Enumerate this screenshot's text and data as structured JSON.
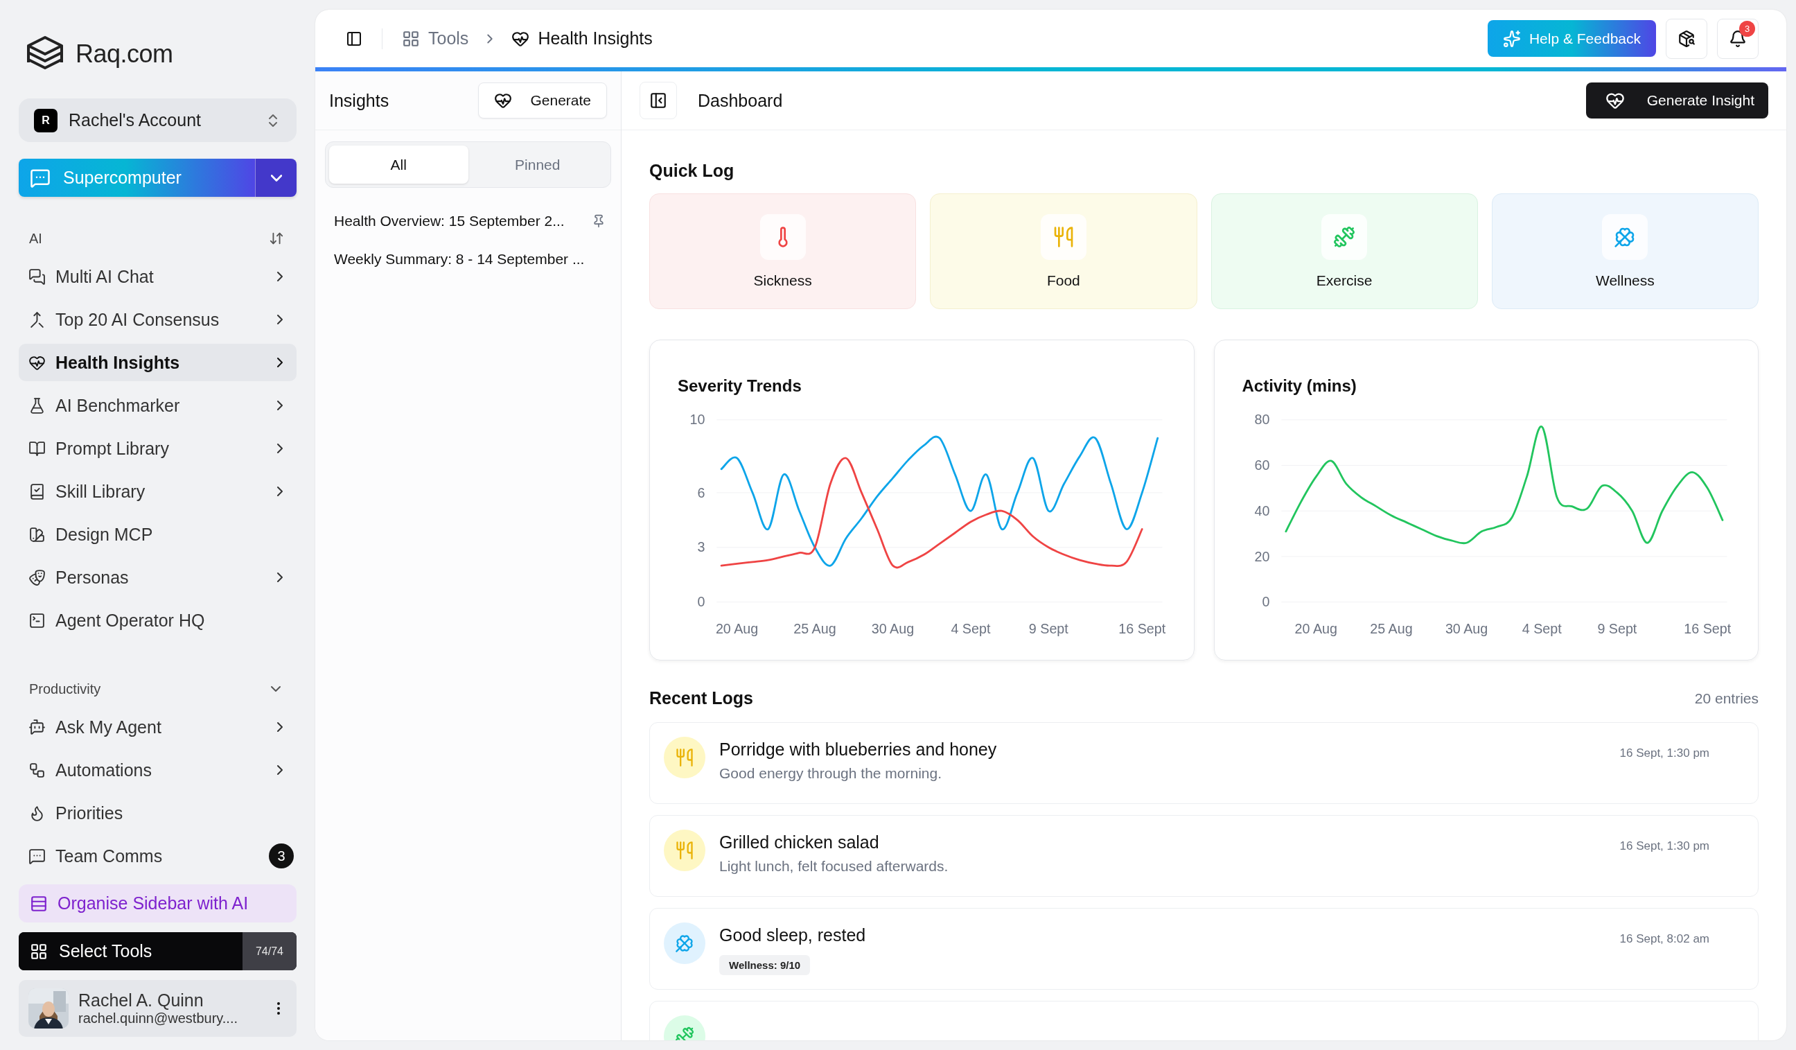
{
  "brand": {
    "name": "Raq.com"
  },
  "account": {
    "initial": "R",
    "name": "Rachel's Account"
  },
  "primary_action": {
    "label": "Supercomputer"
  },
  "sections": [
    {
      "title": "AI",
      "kind": "sortable",
      "items": [
        {
          "label": "Multi AI Chat",
          "expandable": true,
          "selected": false
        },
        {
          "label": "Top 20 AI Consensus",
          "expandable": true,
          "selected": false
        },
        {
          "label": "Health Insights",
          "expandable": true,
          "selected": true
        },
        {
          "label": "AI Benchmarker",
          "expandable": true,
          "selected": false
        },
        {
          "label": "Prompt Library",
          "expandable": true,
          "selected": false
        },
        {
          "label": "Skill Library",
          "expandable": true,
          "selected": false
        },
        {
          "label": "Design MCP",
          "expandable": false,
          "selected": false
        },
        {
          "label": "Personas",
          "expandable": true,
          "selected": false
        },
        {
          "label": "Agent Operator HQ",
          "expandable": false,
          "selected": false
        }
      ]
    },
    {
      "title": "Productivity",
      "kind": "collapsible",
      "expanded": true,
      "items": [
        {
          "label": "Ask My Agent",
          "expandable": true,
          "selected": false
        },
        {
          "label": "Automations",
          "expandable": true,
          "selected": false
        },
        {
          "label": "Priorities",
          "expandable": false,
          "selected": false
        },
        {
          "label": "Team Comms",
          "expandable": false,
          "selected": false,
          "badge": "3"
        }
      ]
    }
  ],
  "organise": {
    "label": "Organise Sidebar with AI"
  },
  "select_tools": {
    "label": "Select Tools",
    "count": "74/74"
  },
  "user": {
    "name": "Rachel A. Quinn",
    "email": "rachel.quinn@westbury...."
  },
  "breadcrumb": [
    {
      "label": "Tools"
    },
    {
      "label": "Health Insights"
    }
  ],
  "help_button": {
    "label": "Help & Feedback"
  },
  "notifications": {
    "count": "3"
  },
  "insights": {
    "title": "Insights",
    "generate": "Generate",
    "tabs": [
      {
        "label": "All",
        "selected": true
      },
      {
        "label": "Pinned",
        "selected": false
      }
    ],
    "items": [
      {
        "title": "Health Overview: 15 September 2...",
        "pinned": true
      },
      {
        "title": "Weekly Summary: 8 - 14 September ...",
        "pinned": false
      }
    ]
  },
  "dashboard": {
    "title": "Dashboard",
    "generate": "Generate Insight",
    "quick_log": {
      "title": "Quick Log",
      "cards": [
        {
          "label": "Sickness",
          "kind": "sickness"
        },
        {
          "label": "Food",
          "kind": "food"
        },
        {
          "label": "Exercise",
          "kind": "exercise"
        },
        {
          "label": "Wellness",
          "kind": "wellness"
        }
      ]
    },
    "charts": [
      {
        "chart_data": {
          "type": "line",
          "title": "Severity Trends",
          "grid": true,
          "categories": [
            null,
            "20 Aug",
            null,
            null,
            null,
            null,
            "25 Aug",
            null,
            null,
            null,
            null,
            "30 Aug",
            null,
            null,
            null,
            null,
            "4 Sept",
            null,
            null,
            null,
            null,
            "9 Sept",
            null,
            null,
            null,
            null,
            null,
            "16 Sept",
            null
          ],
          "ylim": [
            0,
            10
          ],
          "yticks": [
            0,
            3,
            6,
            10
          ],
          "series": [
            {
              "color": "#0ea5e9",
              "values": [
                7.3,
                7.9,
                6.0,
                4.0,
                7.0,
                5.0,
                3.0,
                2.0,
                3.5,
                4.6,
                5.8,
                6.8,
                7.8,
                8.6,
                9.0,
                7.0,
                5.0,
                7.0,
                4.0,
                6.0,
                7.9,
                5.0,
                6.5,
                8.0,
                9.0,
                6.5,
                4.0,
                6.0,
                9.0
              ]
            },
            {
              "color": "#ef4444",
              "values": [
                2.0,
                2.1,
                2.2,
                2.3,
                2.5,
                2.7,
                3.0,
                6.5,
                7.9,
                6.0,
                4.0,
                2.0,
                2.2,
                2.6,
                3.2,
                3.8,
                4.4,
                4.8,
                5.0,
                4.5,
                3.6,
                3.0,
                2.6,
                2.3,
                2.1,
                2.0,
                2.2,
                4.0,
                null
              ]
            }
          ]
        }
      },
      {
        "chart_data": {
          "type": "line",
          "title": "Activity (mins)",
          "grid": true,
          "categories": [
            null,
            null,
            "20 Aug",
            null,
            null,
            null,
            null,
            "25 Aug",
            null,
            null,
            null,
            null,
            "30 Aug",
            null,
            null,
            null,
            null,
            "4 Sept",
            null,
            null,
            null,
            null,
            "9 Sept",
            null,
            null,
            null,
            null,
            null,
            "16 Sept",
            null
          ],
          "ylim": [
            0,
            80
          ],
          "yticks": [
            0,
            20,
            40,
            60,
            80
          ],
          "series": [
            {
              "color": "#22c55e",
              "values": [
                31,
                44,
                55,
                62,
                52,
                46,
                42,
                38,
                35,
                32,
                29,
                27,
                26,
                31,
                33,
                37,
                55,
                77,
                46,
                42,
                41,
                51,
                48,
                40,
                26,
                40,
                51,
                57,
                50,
                36
              ]
            }
          ]
        }
      }
    ],
    "recent": {
      "title": "Recent Logs",
      "count": "20 entries",
      "logs": [
        {
          "kind": "food",
          "title": "Porridge with blueberries and honey",
          "note": "Good energy through the morning.",
          "time": "16 Sept, 1:30 pm"
        },
        {
          "kind": "food",
          "title": "Grilled chicken salad",
          "note": "Light lunch, felt focused afterwards.",
          "time": "16 Sept, 1:30 pm"
        },
        {
          "kind": "wellness",
          "title": "Good sleep, rested",
          "tag": "Wellness: 9/10",
          "time": "16 Sept, 8:02 am"
        },
        {
          "kind": "exercise"
        }
      ]
    }
  }
}
